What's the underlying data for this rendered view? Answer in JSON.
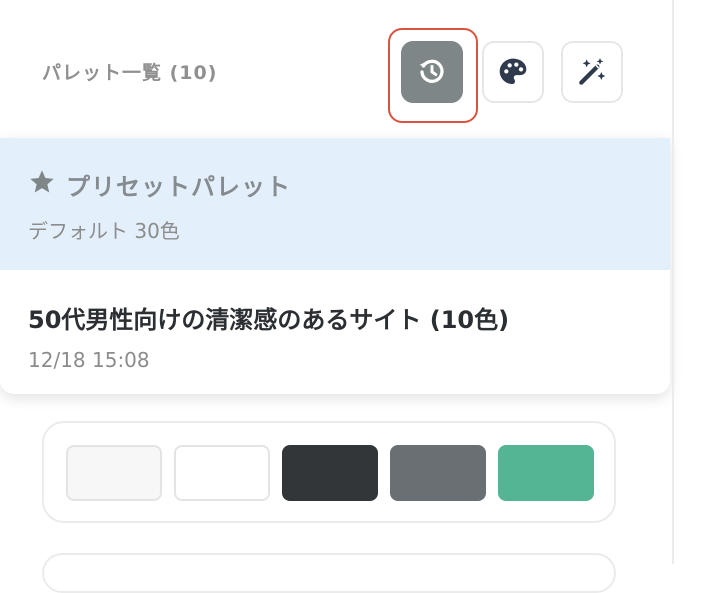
{
  "header": {
    "title": "パレット一覧 (10)"
  },
  "toolbar": {
    "history_icon": "history-icon",
    "palette_icon": "palette-icon",
    "magic_icon": "magic-wand-icon"
  },
  "dropdown": {
    "preset": {
      "icon": "star-icon",
      "title": "プリセットパレット",
      "subtitle": "デフォルト 30色"
    },
    "history": [
      {
        "title": "50代男性向けの清潔感のあるサイト (10色)",
        "timestamp": "12/18 15:08"
      }
    ]
  },
  "swatches": [
    {
      "color": "#f7f7f7"
    },
    {
      "color": "#ffffff"
    },
    {
      "color": "#323638"
    },
    {
      "color": "#6a6f74"
    },
    {
      "color": "#53b594"
    }
  ],
  "colors": {
    "highlight": "#d9533f",
    "preset_bg": "#e3f0fb",
    "history_btn_bg": "#7f8688"
  }
}
